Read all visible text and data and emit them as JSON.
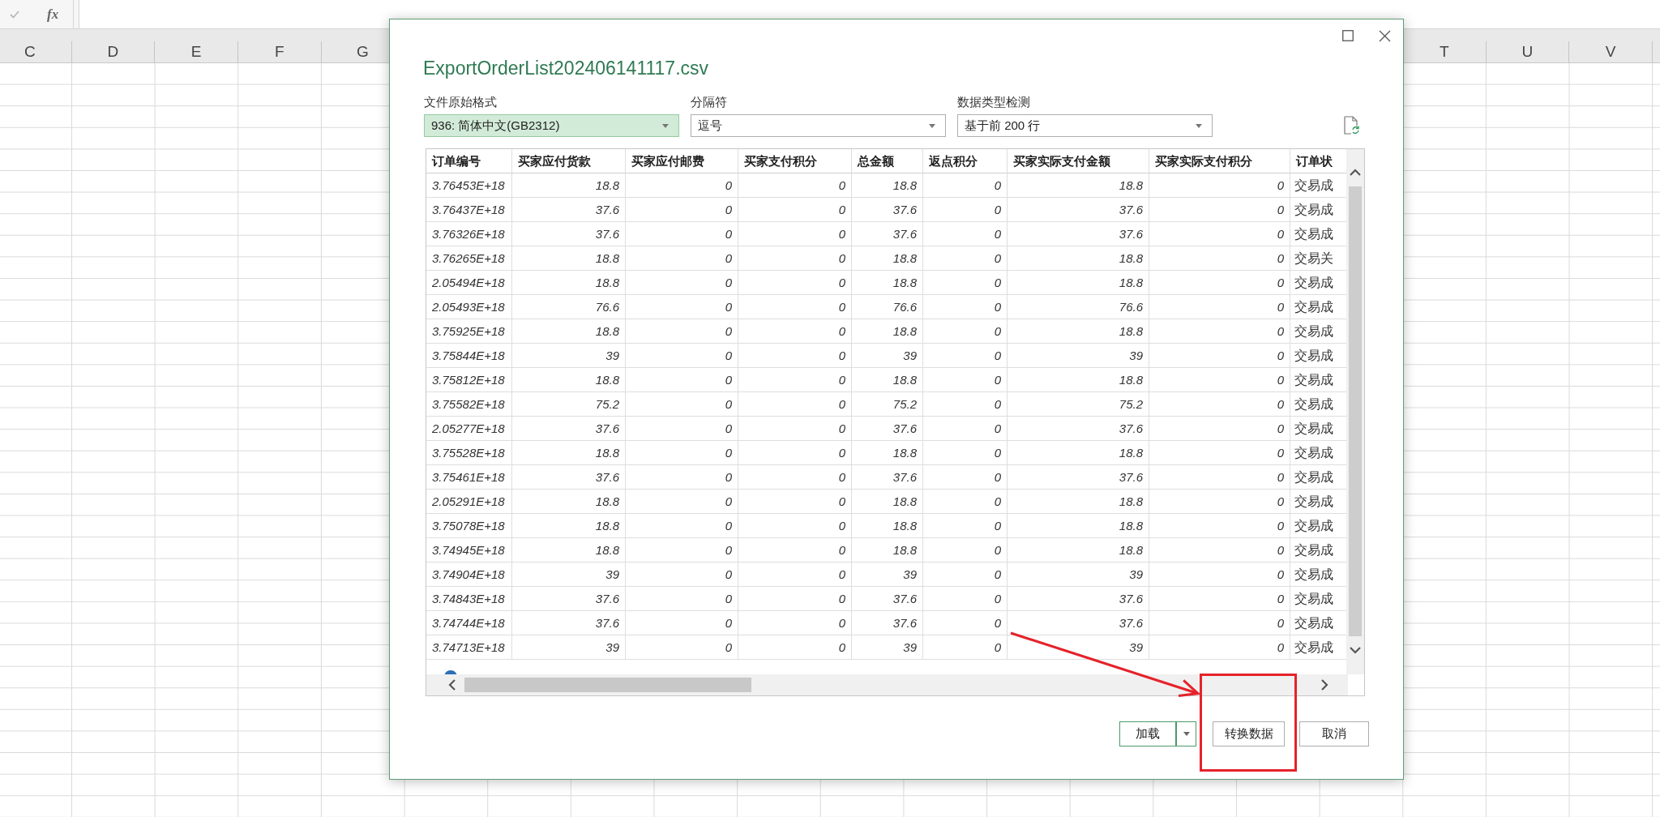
{
  "formula_bar": {
    "fx": "fx"
  },
  "sheet": {
    "left_columns": [
      "C",
      "D",
      "E",
      "F",
      "G"
    ],
    "right_columns": [
      "T",
      "U",
      "V"
    ]
  },
  "dialog": {
    "title": "ExportOrderList202406141117.csv",
    "options": [
      {
        "label": "文件原始格式",
        "value": "936: 简体中文(GB2312)",
        "highlighted": true
      },
      {
        "label": "分隔符",
        "value": "逗号",
        "highlighted": false
      },
      {
        "label": "数据类型检测",
        "value": "基于前 200 行",
        "highlighted": false
      }
    ],
    "preview": {
      "columns": [
        {
          "label": "订单编号",
          "kind": "id"
        },
        {
          "label": "买家应付货款",
          "kind": "number"
        },
        {
          "label": "买家应付邮费",
          "kind": "number"
        },
        {
          "label": "买家支付积分",
          "kind": "number"
        },
        {
          "label": "总金额",
          "kind": "number"
        },
        {
          "label": "返点积分",
          "kind": "number"
        },
        {
          "label": "买家实际支付金额",
          "kind": "number"
        },
        {
          "label": "买家实际支付积分",
          "kind": "number"
        },
        {
          "label": "订单状",
          "kind": "text"
        }
      ],
      "rows": [
        [
          "3.76453E+18",
          "18.8",
          "0",
          "0",
          "18.8",
          "0",
          "18.8",
          "0",
          "交易成"
        ],
        [
          "3.76437E+18",
          "37.6",
          "0",
          "0",
          "37.6",
          "0",
          "37.6",
          "0",
          "交易成"
        ],
        [
          "3.76326E+18",
          "37.6",
          "0",
          "0",
          "37.6",
          "0",
          "37.6",
          "0",
          "交易成"
        ],
        [
          "3.76265E+18",
          "18.8",
          "0",
          "0",
          "18.8",
          "0",
          "18.8",
          "0",
          "交易关"
        ],
        [
          "2.05494E+18",
          "18.8",
          "0",
          "0",
          "18.8",
          "0",
          "18.8",
          "0",
          "交易成"
        ],
        [
          "2.05493E+18",
          "76.6",
          "0",
          "0",
          "76.6",
          "0",
          "76.6",
          "0",
          "交易成"
        ],
        [
          "3.75925E+18",
          "18.8",
          "0",
          "0",
          "18.8",
          "0",
          "18.8",
          "0",
          "交易成"
        ],
        [
          "3.75844E+18",
          "39",
          "0",
          "0",
          "39",
          "0",
          "39",
          "0",
          "交易成"
        ],
        [
          "3.75812E+18",
          "18.8",
          "0",
          "0",
          "18.8",
          "0",
          "18.8",
          "0",
          "交易成"
        ],
        [
          "3.75582E+18",
          "75.2",
          "0",
          "0",
          "75.2",
          "0",
          "75.2",
          "0",
          "交易成"
        ],
        [
          "2.05277E+18",
          "37.6",
          "0",
          "0",
          "37.6",
          "0",
          "37.6",
          "0",
          "交易成"
        ],
        [
          "3.75528E+18",
          "18.8",
          "0",
          "0",
          "18.8",
          "0",
          "18.8",
          "0",
          "交易成"
        ],
        [
          "3.75461E+18",
          "37.6",
          "0",
          "0",
          "37.6",
          "0",
          "37.6",
          "0",
          "交易成"
        ],
        [
          "2.05291E+18",
          "18.8",
          "0",
          "0",
          "18.8",
          "0",
          "18.8",
          "0",
          "交易成"
        ],
        [
          "3.75078E+18",
          "18.8",
          "0",
          "0",
          "18.8",
          "0",
          "18.8",
          "0",
          "交易成"
        ],
        [
          "3.74945E+18",
          "18.8",
          "0",
          "0",
          "18.8",
          "0",
          "18.8",
          "0",
          "交易成"
        ],
        [
          "3.74904E+18",
          "39",
          "0",
          "0",
          "39",
          "0",
          "39",
          "0",
          "交易成"
        ],
        [
          "3.74843E+18",
          "37.6",
          "0",
          "0",
          "37.6",
          "0",
          "37.6",
          "0",
          "交易成"
        ],
        [
          "3.74744E+18",
          "37.6",
          "0",
          "0",
          "37.6",
          "0",
          "37.6",
          "0",
          "交易成"
        ],
        [
          "3.74713E+18",
          "39",
          "0",
          "0",
          "39",
          "0",
          "39",
          "0",
          "交易成"
        ]
      ]
    },
    "buttons": [
      {
        "label": "加载",
        "kind": "split",
        "default": true
      },
      {
        "label": "转换数据",
        "kind": "plain",
        "default": false
      },
      {
        "label": "取消",
        "kind": "plain",
        "default": false
      }
    ]
  }
}
